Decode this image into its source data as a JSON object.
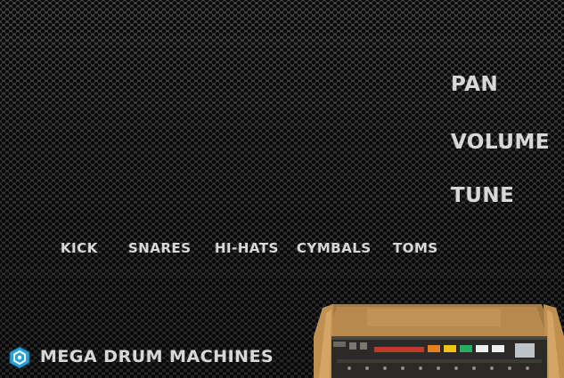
{
  "params": {
    "pan": "PAN",
    "volume": "VOLUME",
    "tune": "TUNE"
  },
  "tabs": {
    "kick": "KICK",
    "snares": "SNARES",
    "hihats": "HI-HATS",
    "cymbals": "CYMBALS",
    "toms": "TOMS"
  },
  "brand": {
    "title": "MEGA DRUM MACHINES",
    "logo_icon": "hexagon-logo-icon"
  },
  "colors": {
    "text": "#d8d8d8",
    "background": "#2b2b2b",
    "accent_blue": "#2aa3d8",
    "machine_wood": "#b8874a"
  }
}
